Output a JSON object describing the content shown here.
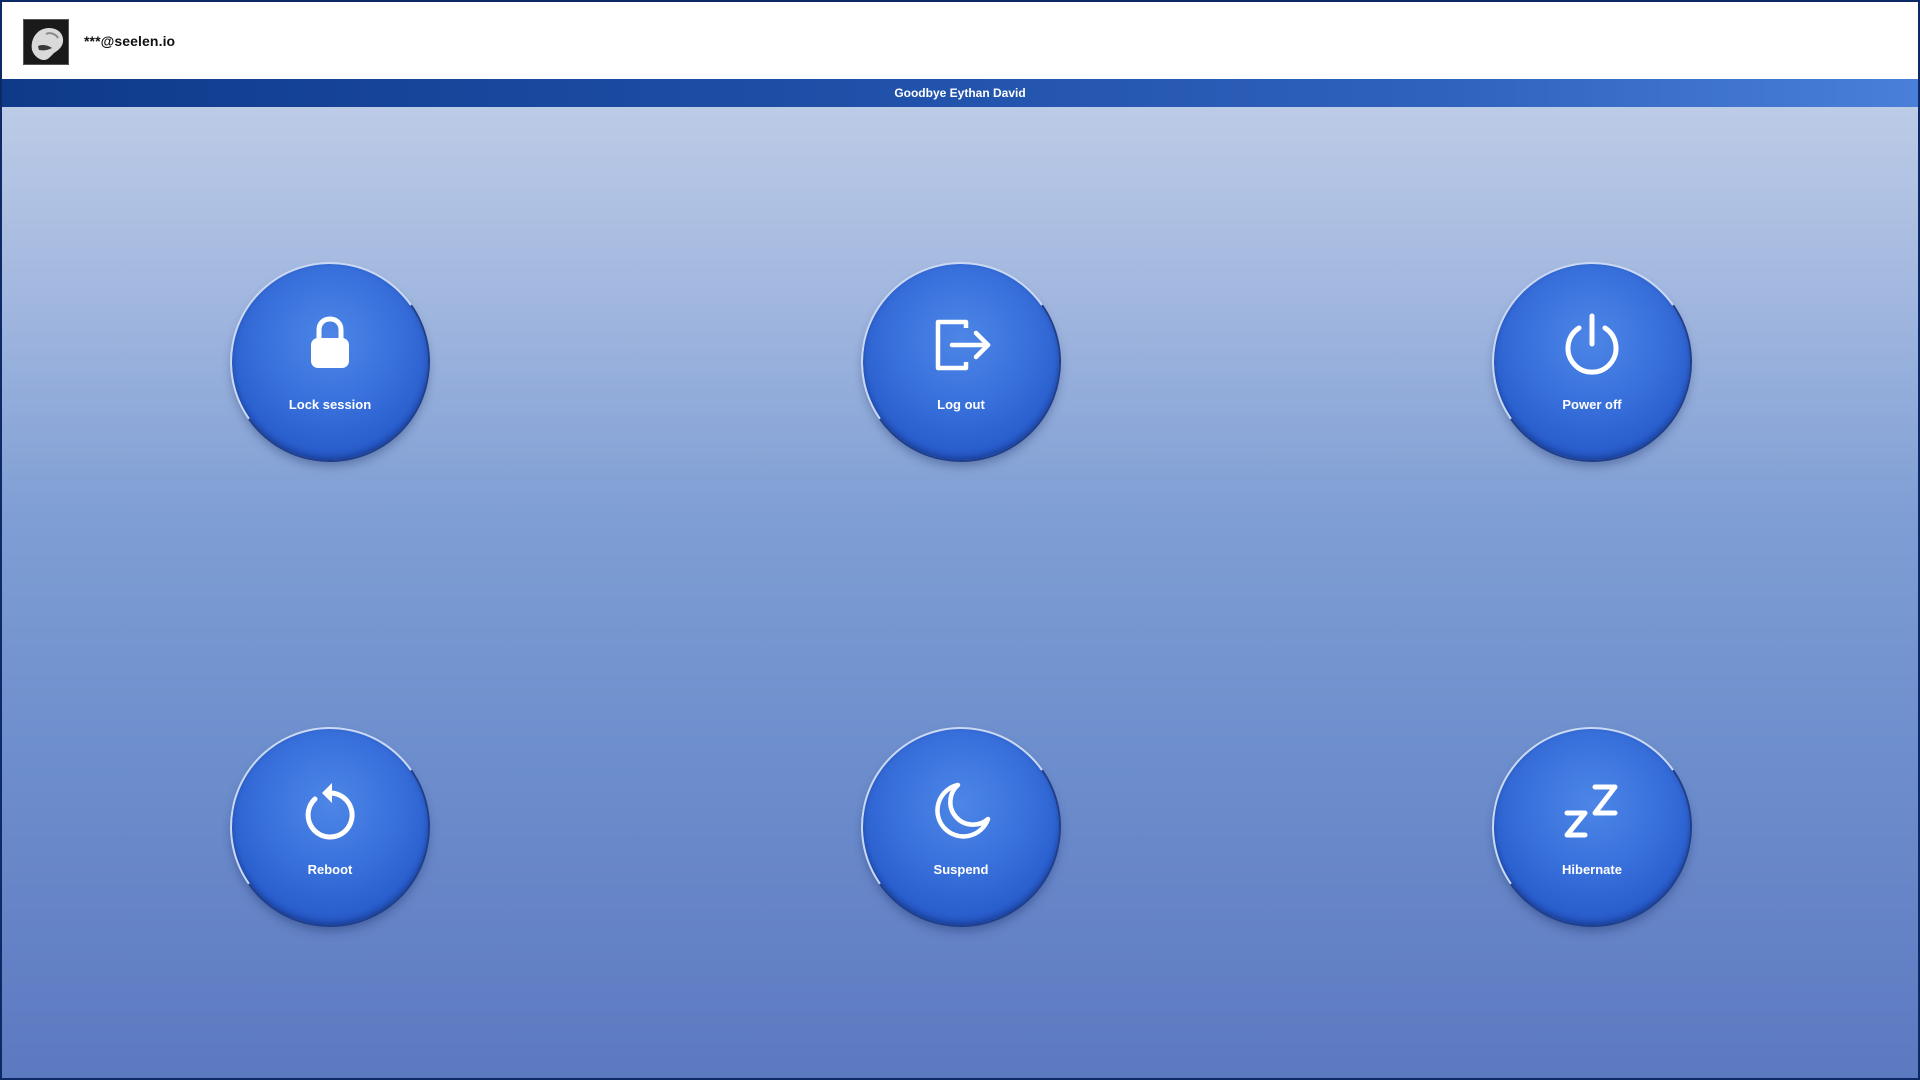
{
  "user": {
    "email": "***@seelen.io",
    "avatar_icon": "user-avatar"
  },
  "banner": {
    "greeting": "Goodbye Eythan David"
  },
  "actions": [
    {
      "label": "Lock session",
      "icon": "lock-icon"
    },
    {
      "label": "Log out",
      "icon": "logout-icon"
    },
    {
      "label": "Power off",
      "icon": "power-icon"
    },
    {
      "label": "Reboot",
      "icon": "reboot-icon"
    },
    {
      "label": "Suspend",
      "icon": "moon-icon"
    },
    {
      "label": "Hibernate",
      "icon": "sleep-zz-icon"
    }
  ],
  "colors": {
    "banner_start": "#0f3a8a",
    "banner_end": "#4a7fd9",
    "button": "#3a72dd",
    "background_top": "#bccbe6",
    "background_bottom": "#5c79c0"
  }
}
